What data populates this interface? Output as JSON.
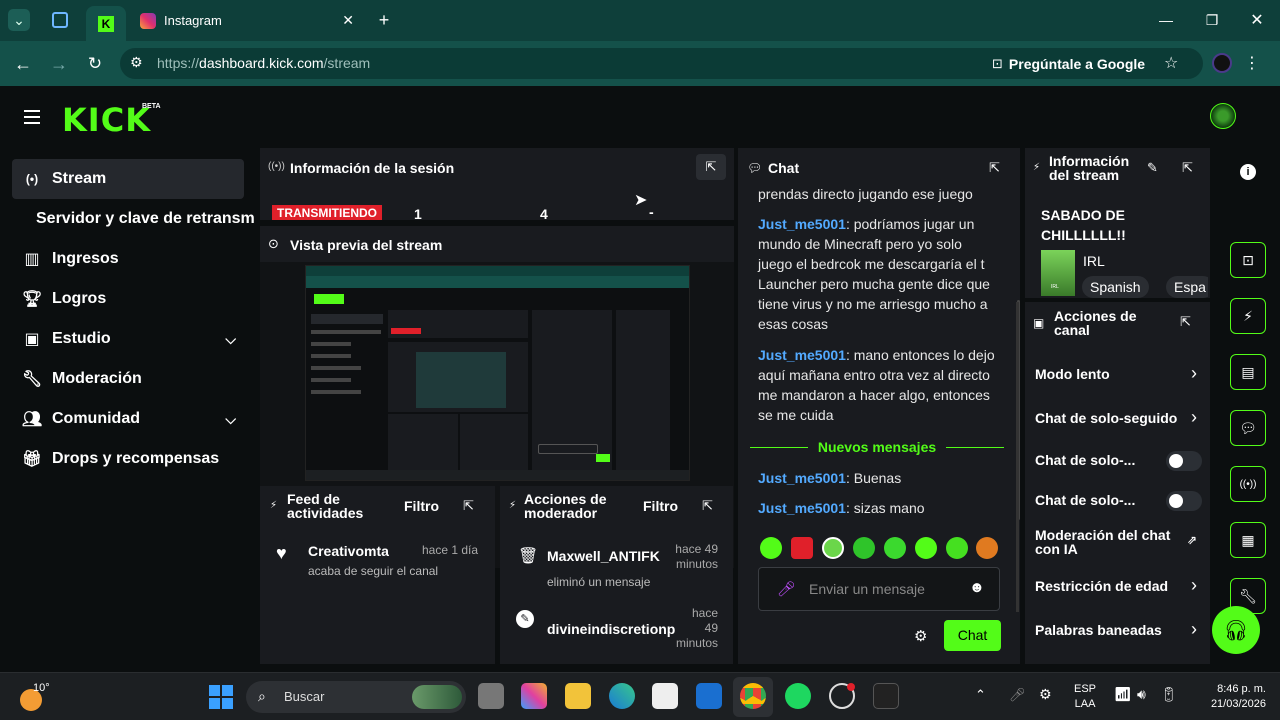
{
  "browser": {
    "tab_title": "Instagram",
    "url_scheme": "https://",
    "url_host": "dashboard.kick.com",
    "url_path": "/stream",
    "google_button": "Pregúntale a Google"
  },
  "kick": {
    "logo": "KICK",
    "beta": "BETA"
  },
  "sidebar": {
    "items": [
      {
        "label": "Stream"
      },
      {
        "label": "Servidor y clave de retransm"
      },
      {
        "label": "Ingresos"
      },
      {
        "label": "Logros"
      },
      {
        "label": "Estudio"
      },
      {
        "label": "Moderación"
      },
      {
        "label": "Comunidad"
      },
      {
        "label": "Drops y recompensas"
      }
    ]
  },
  "session": {
    "title": "Información de la sesión",
    "live_badge": "TRANSMITIENDO",
    "stat1": "1",
    "stat2": "4",
    "stat3": "-"
  },
  "preview": {
    "title": "Vista previa del stream"
  },
  "feed": {
    "title_line1": "Feed de",
    "title_line2": "actividades",
    "filter": "Filtro",
    "item_user": "Creativomta",
    "item_time": "hace 1 día",
    "item_text": "acaba de seguir el canal"
  },
  "modactions": {
    "title_line1": "Acciones de",
    "title_line2": "moderador",
    "filter": "Filtro",
    "items": [
      {
        "user": "Maxwell_ANTIFK",
        "time1": "hace 49",
        "time2": "minutos",
        "text": "eliminó un mensaje"
      },
      {
        "user": "divineindiscretionp",
        "time1": "hace",
        "time2": "49",
        "time3": "minutos"
      }
    ]
  },
  "chat": {
    "title": "Chat",
    "line0": "prendas directo jugando ese juego",
    "messages": [
      {
        "user": "Just_me5001",
        "text": ": podríamos jugar un mundo de Minecraft pero yo solo juego el bedrcok me descargaría el t Launcher pero mucha gente dice que tiene virus y no me arriesgo mucho a esas cosas"
      },
      {
        "user": "Just_me5001",
        "text": ": mano entonces lo dejo aquí mañana entro otra vez al directo me mandaron a hacer algo, entonces se me cuida"
      },
      {
        "user": "Just_me5001",
        "text": ": Buenas"
      },
      {
        "user": "Just_me5001",
        "text": ": sizas mano"
      }
    ],
    "new_messages": "Nuevos mensajes",
    "placeholder": "Enviar un mensaje",
    "send": "Chat"
  },
  "streaminfo": {
    "title_line1": "Información",
    "title_line2": "del stream",
    "stream_title_line1": "SABADO DE",
    "stream_title_line2": "CHILLLLLL!!",
    "category": "IRL",
    "thumb_label": "IRL",
    "tag1": "Spanish",
    "tag2": "Espa"
  },
  "channel": {
    "title_line1": "Acciones de",
    "title_line2": "canal",
    "rows": [
      {
        "label": "Modo lento"
      },
      {
        "label": "Chat de solo-seguido"
      },
      {
        "label": "Chat de solo-..."
      },
      {
        "label": "Chat de solo-..."
      },
      {
        "label_line1": "Moderación del chat",
        "label_line2": "con IA"
      },
      {
        "label": "Restricción de edad"
      },
      {
        "label": "Palabras baneadas"
      }
    ]
  },
  "taskbar": {
    "weather": "10°",
    "search": "Buscar",
    "lang1": "ESP",
    "lang2": "LAA",
    "time": "8:46 p. m.",
    "date": "21/03/2026"
  },
  "colors": {
    "kick_green": "#53fc18",
    "live_red": "#e0202a",
    "username_blue": "#53aaff",
    "chrome_teal": "#14514a"
  }
}
